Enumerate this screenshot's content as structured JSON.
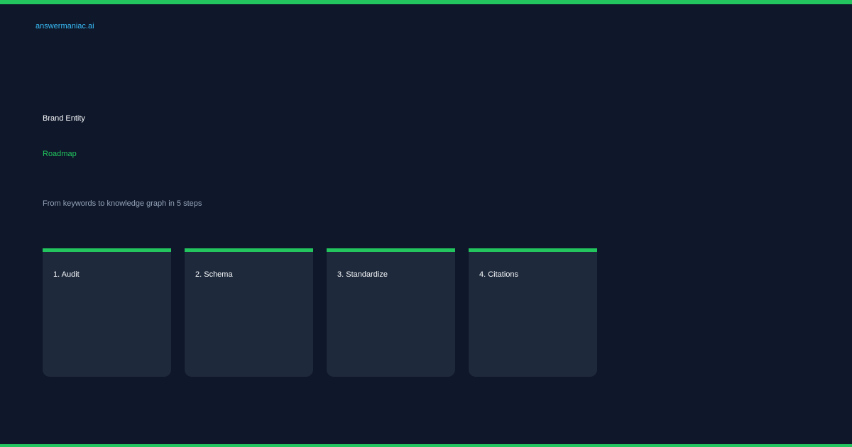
{
  "brand": "answermaniac.ai",
  "title": "Brand Entity",
  "subtitle": "Roadmap",
  "tagline": "From keywords to knowledge graph in 5 steps",
  "steps": [
    {
      "label": "1. Audit"
    },
    {
      "label": "2. Schema"
    },
    {
      "label": "3. Standardize"
    },
    {
      "label": "4. Citations"
    }
  ],
  "colors": {
    "background": "#0f172a",
    "accent": "#22c55e",
    "brand": "#38bdf8",
    "card": "#1e293b",
    "muted_text": "#94a3b8"
  }
}
